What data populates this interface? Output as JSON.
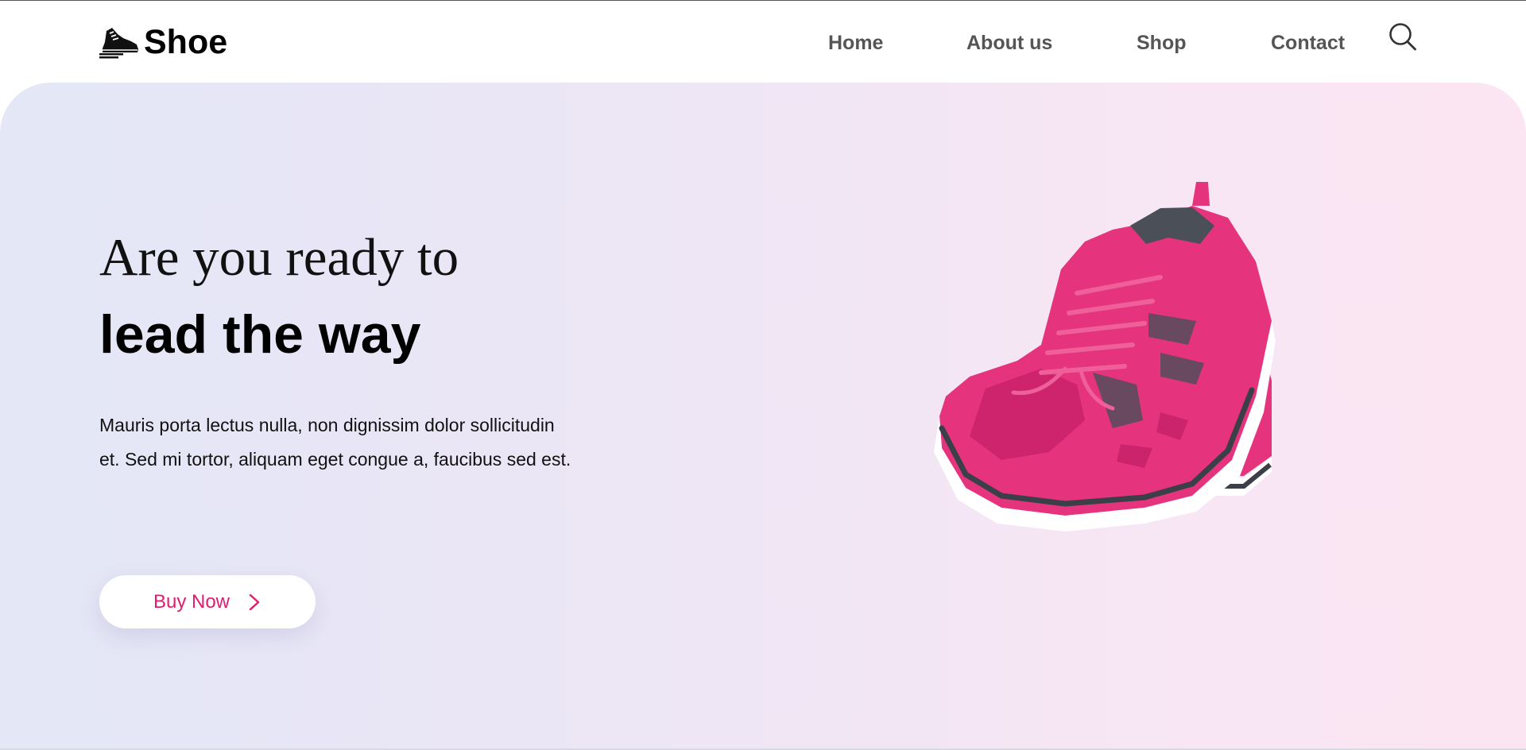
{
  "brand": {
    "name": "Shoe",
    "logo_icon": "sneaker-icon"
  },
  "nav": {
    "items": [
      {
        "label": "Home"
      },
      {
        "label": "About us"
      },
      {
        "label": "Shop"
      },
      {
        "label": "Contact"
      }
    ],
    "search_icon": "search-icon"
  },
  "hero": {
    "heading_line1": "Are you ready to",
    "heading_line2": "lead the way",
    "description": "Mauris porta lectus nulla, non dignissim dolor sollicitudin et. Sed mi tortor, aliquam eget congue a, faucibus sed est.",
    "cta_label": "Buy Now",
    "cta_icon": "chevron-right-icon",
    "product_image": "pink-sneakers-image"
  },
  "colors": {
    "accent": "#e4196f",
    "nav_text": "#555555",
    "hero_gradient_start": "#e3e7f6",
    "hero_gradient_end": "#fce5f3",
    "shoe_pink": "#e5337d",
    "shoe_gray": "#4a4f58"
  }
}
